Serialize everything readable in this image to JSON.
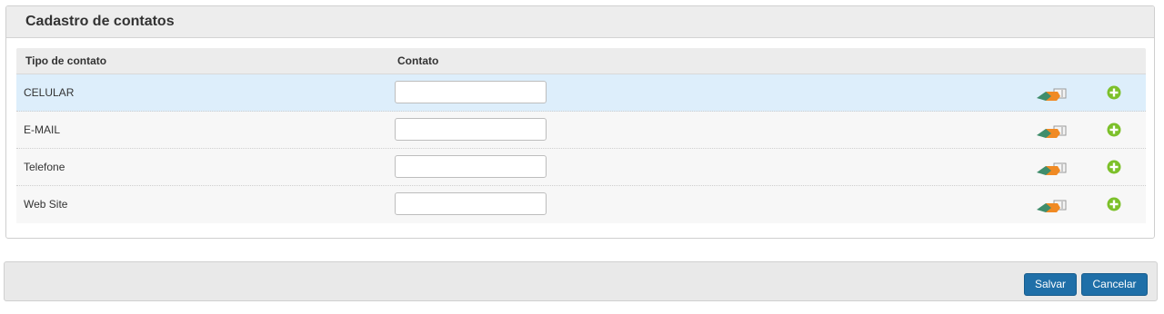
{
  "panel": {
    "title": "Cadastro de contatos"
  },
  "grid": {
    "columns": [
      "Tipo de contato",
      "Contato"
    ],
    "rows": [
      {
        "type": "CELULAR",
        "value": ""
      },
      {
        "type": "E-MAIL",
        "value": ""
      },
      {
        "type": "Telefone",
        "value": ""
      },
      {
        "type": "Web Site",
        "value": ""
      }
    ],
    "row_icons": [
      "eraser-icon",
      "add-circle-icon"
    ]
  },
  "footer": {
    "save_label": "Salvar",
    "cancel_label": "Cancelar"
  },
  "colors": {
    "button": "#1f6fa8",
    "selected_row": "#ddeefb",
    "add_icon": "#7cc02a"
  }
}
